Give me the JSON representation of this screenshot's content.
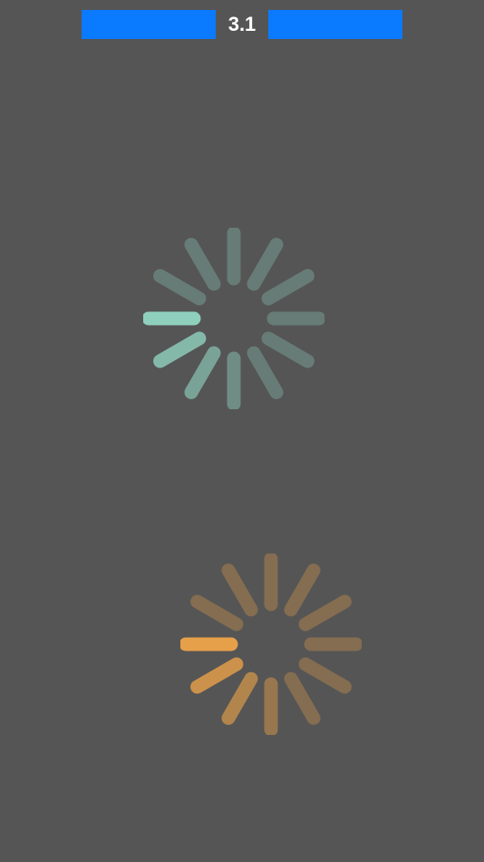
{
  "controls": {
    "left_button": {
      "label": ""
    },
    "value": "3.1",
    "right_button": {
      "label": ""
    }
  },
  "colors": {
    "background": "#555555",
    "button": "#0a7aff",
    "value_text": "#ffffff"
  },
  "spinners": [
    {
      "name": "teal-activity-indicator",
      "color": "#8fd0bd",
      "spokes": 12,
      "active_spoke": 9
    },
    {
      "name": "orange-activity-indicator",
      "color": "#e7a04a",
      "spokes": 12,
      "active_spoke": 9
    }
  ]
}
